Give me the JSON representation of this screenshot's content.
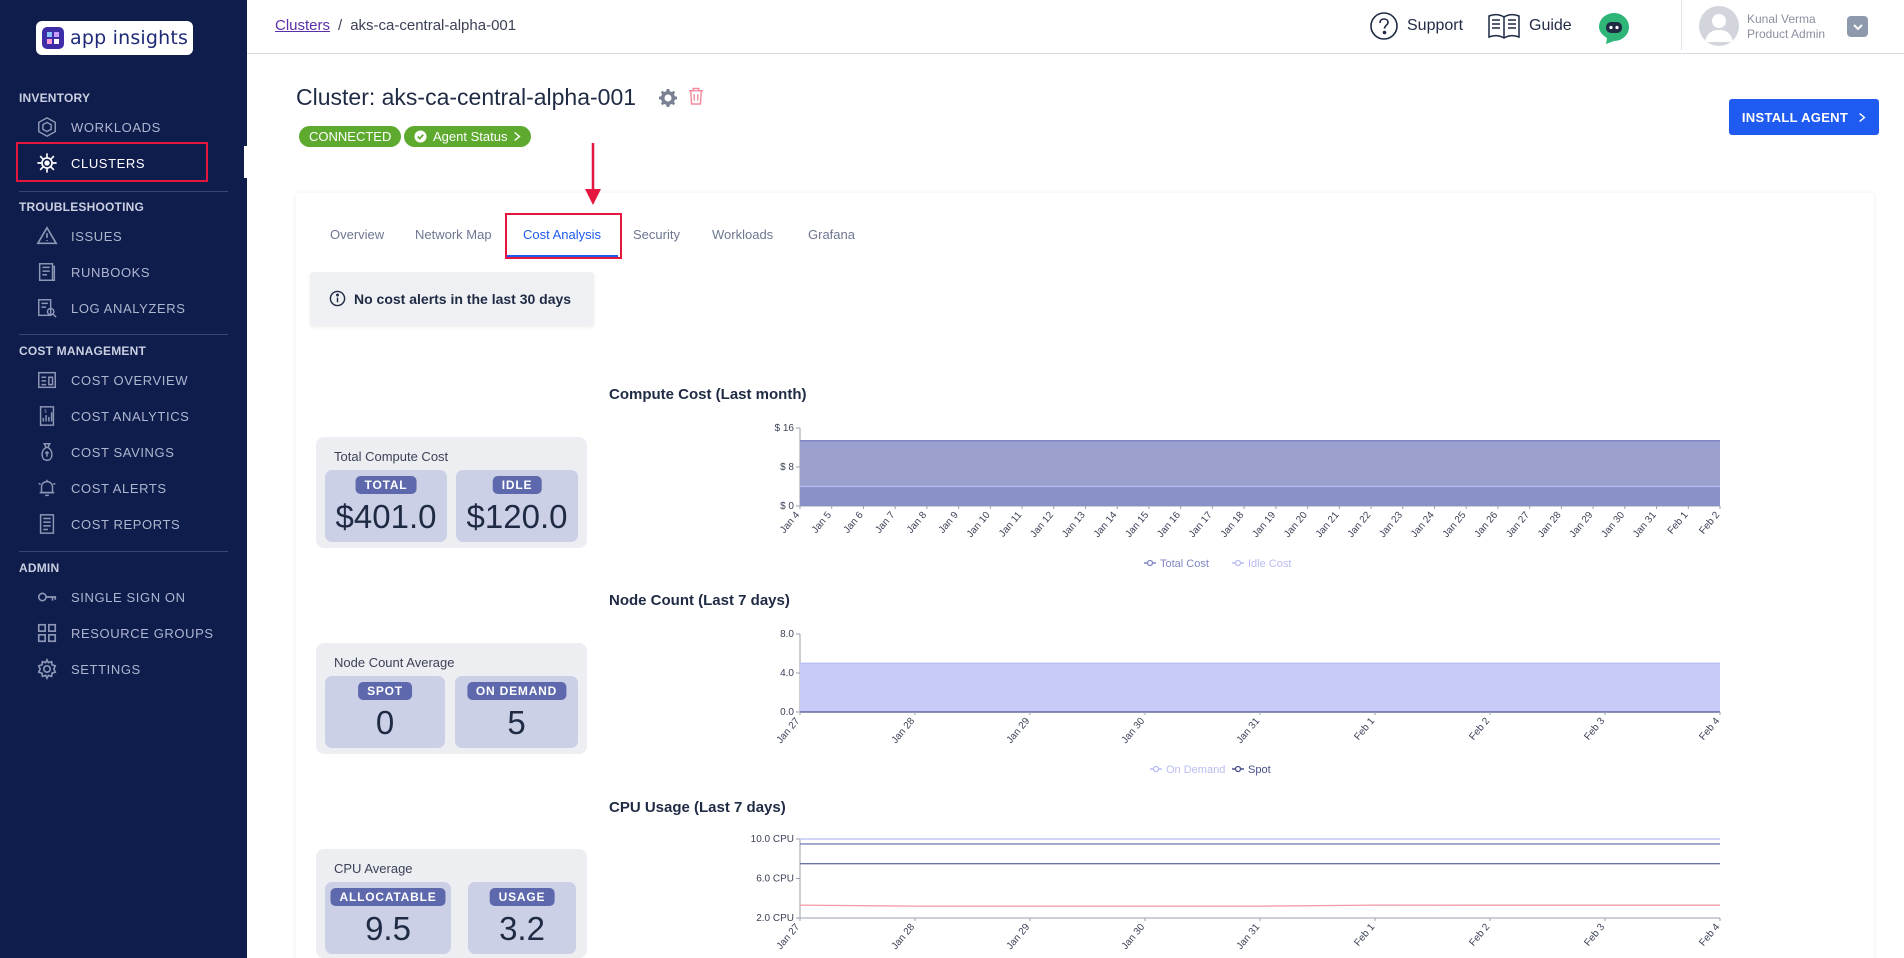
{
  "app": {
    "logo_text": "app insights"
  },
  "sidebar": {
    "sections": {
      "inventory": "INVENTORY",
      "troubleshooting": "TROUBLESHOOTING",
      "cost_management": "COST MANAGEMENT",
      "admin": "ADMIN"
    },
    "items": {
      "workloads": "WORKLOADS",
      "clusters": "CLUSTERS",
      "issues": "ISSUES",
      "runbooks": "RUNBOOKS",
      "log_analyzers": "LOG ANALYZERS",
      "cost_overview": "COST OVERVIEW",
      "cost_analytics": "COST ANALYTICS",
      "cost_savings": "COST SAVINGS",
      "cost_alerts": "COST ALERTS",
      "cost_reports": "COST REPORTS",
      "single_sign_on": "SINGLE SIGN ON",
      "resource_groups": "RESOURCE GROUPS",
      "settings": "SETTINGS"
    },
    "active_item": "clusters"
  },
  "topbar": {
    "breadcrumb_root": "Clusters",
    "breadcrumb_sep": "/",
    "breadcrumb_current": "aks-ca-central-alpha-001",
    "support": "Support",
    "guide": "Guide",
    "user_name": "Kunal Verma",
    "user_role": "Product Admin"
  },
  "header": {
    "title": "Cluster: aks-ca-central-alpha-001",
    "status_badge": "CONNECTED",
    "agent_status": "Agent Status",
    "install_button": "INSTALL AGENT"
  },
  "tabs": [
    "Overview",
    "Network Map",
    "Cost Analysis",
    "Security",
    "Workloads",
    "Grafana"
  ],
  "active_tab": "Cost Analysis",
  "alert": {
    "text": "No cost alerts in the last 30 days"
  },
  "metrics": {
    "compute": {
      "title": "Total Compute Cost",
      "a_label": "TOTAL",
      "a_value": "$401.0",
      "b_label": "IDLE",
      "b_value": "$120.0"
    },
    "nodes": {
      "title": "Node Count Average",
      "a_label": "SPOT",
      "a_value": "0",
      "b_label": "ON DEMAND",
      "b_value": "5"
    },
    "cpu": {
      "title": "CPU Average",
      "a_label": "ALLOCATABLE",
      "a_value": "9.5",
      "b_label": "USAGE",
      "b_value": "3.2"
    }
  },
  "colors": {
    "sidebar_bg": "#0f1d4d",
    "accent": "#1f5bf0",
    "highlight": "#e5173f",
    "badge_green": "#5daa2e"
  },
  "chart_data": [
    {
      "type": "area",
      "title": "Compute Cost (Last month)",
      "yticks": [
        "$ 16",
        "$ 8",
        "$ 0"
      ],
      "ylim": [
        0,
        16
      ],
      "x": [
        "Jan 4",
        "Jan 5",
        "Jan 6",
        "Jan 7",
        "Jan 8",
        "Jan 9",
        "Jan 10",
        "Jan 11",
        "Jan 12",
        "Jan 13",
        "Jan 14",
        "Jan 15",
        "Jan 16",
        "Jan 17",
        "Jan 18",
        "Jan 19",
        "Jan 20",
        "Jan 21",
        "Jan 22",
        "Jan 23",
        "Jan 24",
        "Jan 25",
        "Jan 26",
        "Jan 27",
        "Jan 28",
        "Jan 29",
        "Jan 30",
        "Jan 31",
        "Feb 1",
        "Feb 2"
      ],
      "series": [
        {
          "name": "Total Cost",
          "color": "#7f86c4",
          "fill": "#9ba0cf",
          "values": [
            13.4,
            13.4,
            13.4,
            13.4,
            13.4,
            13.4,
            13.4,
            13.4,
            13.4,
            13.4,
            13.4,
            13.4,
            13.4,
            13.4,
            13.4,
            13.4,
            13.4,
            13.4,
            13.4,
            13.4,
            13.4,
            13.4,
            13.4,
            13.4,
            13.4,
            13.4,
            13.4,
            13.4,
            13.4,
            13.4
          ]
        },
        {
          "name": "Idle Cost",
          "color": "#b8bcf2",
          "fill": "#8a90c8",
          "values": [
            4.0,
            4.0,
            4.0,
            4.0,
            4.0,
            4.0,
            4.0,
            4.0,
            4.0,
            4.0,
            4.0,
            4.0,
            4.0,
            4.0,
            4.0,
            4.0,
            4.0,
            4.0,
            4.0,
            4.0,
            4.0,
            4.0,
            4.0,
            4.0,
            4.0,
            4.0,
            4.0,
            4.0,
            4.0,
            4.0
          ]
        }
      ]
    },
    {
      "type": "area",
      "title": "Node Count (Last 7 days)",
      "yticks": [
        "8.0",
        "4.0",
        "0.0"
      ],
      "ylim": [
        0,
        8
      ],
      "x": [
        "Jan 27",
        "Jan 28",
        "Jan 29",
        "Jan 30",
        "Jan 31",
        "Feb 1",
        "Feb 2",
        "Feb 3",
        "Feb 4"
      ],
      "series": [
        {
          "name": "On Demand",
          "color": "#b8bcf2",
          "fill": "#c7cbf7",
          "values": [
            5,
            5,
            5,
            5,
            5,
            5,
            5,
            5,
            5
          ]
        },
        {
          "name": "Spot",
          "color": "#4a4f8c",
          "fill": "#4a4f8c",
          "values": [
            0,
            0,
            0,
            0,
            0,
            0,
            0,
            0,
            0
          ]
        }
      ]
    },
    {
      "type": "line",
      "title": "CPU Usage (Last 7 days)",
      "yticks": [
        "10.0 CPU",
        "6.0 CPU",
        "2.0 CPU"
      ],
      "ylim": [
        2,
        10
      ],
      "x": [
        "Jan 27",
        "Jan 28",
        "Jan 29",
        "Jan 30",
        "Jan 31",
        "Feb 1",
        "Feb 2",
        "Feb 3",
        "Feb 4"
      ],
      "series": [
        {
          "color": "#b8bcf2",
          "values": [
            10,
            10,
            10,
            10,
            10,
            10,
            10,
            10,
            10
          ]
        },
        {
          "color": "#7c83b5",
          "values": [
            9.5,
            9.5,
            9.5,
            9.5,
            9.5,
            9.5,
            9.5,
            9.5,
            9.5
          ]
        },
        {
          "color": "#6b73a8",
          "values": [
            7.5,
            7.5,
            7.5,
            7.5,
            7.5,
            7.5,
            7.5,
            7.5,
            7.5
          ]
        },
        {
          "color": "#f29aa8",
          "values": [
            3.3,
            3.2,
            3.2,
            3.2,
            3.2,
            3.3,
            3.3,
            3.3,
            3.3
          ]
        }
      ]
    }
  ]
}
